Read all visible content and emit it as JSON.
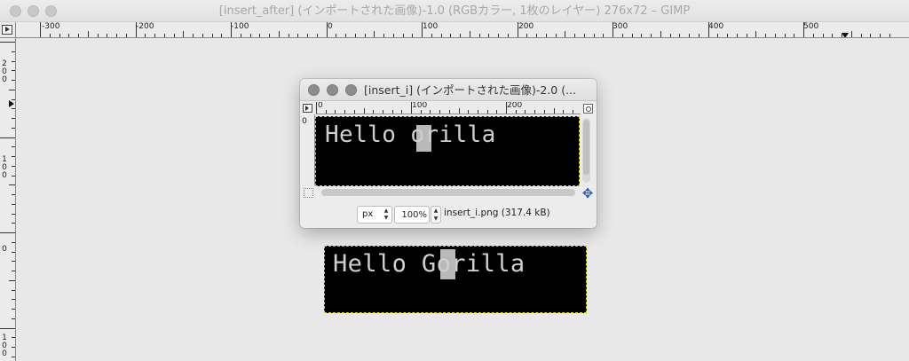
{
  "main_window": {
    "title": "[insert_after] (インポートされた画像)-1.0 (RGBカラー, 1枚のレイヤー) 276x72 – GIMP",
    "h_ruler_labels": [
      "-300",
      "-200",
      "-100",
      "0",
      "100",
      "200",
      "300",
      "400",
      "500"
    ],
    "v_ruler_labels": [
      "2 0 0",
      "1 0 0",
      "0",
      "1 0 0"
    ],
    "image_text": "Hello Gorilla"
  },
  "sub_window": {
    "title": "[insert_i] (インポートされた画像)-2.0 (...",
    "h_ruler_labels": [
      "0",
      "100",
      "200"
    ],
    "v_ruler_labels": [
      "0"
    ],
    "image_text": "Hello orilla",
    "unit": "px",
    "zoom": "100%",
    "file_info": "insert_i.png (317.4 kB)"
  },
  "colors": {
    "selection_border": "#d6d100",
    "image_background": "#000000",
    "text": "#cfcfcf",
    "cursor": "#b9b9b9"
  }
}
